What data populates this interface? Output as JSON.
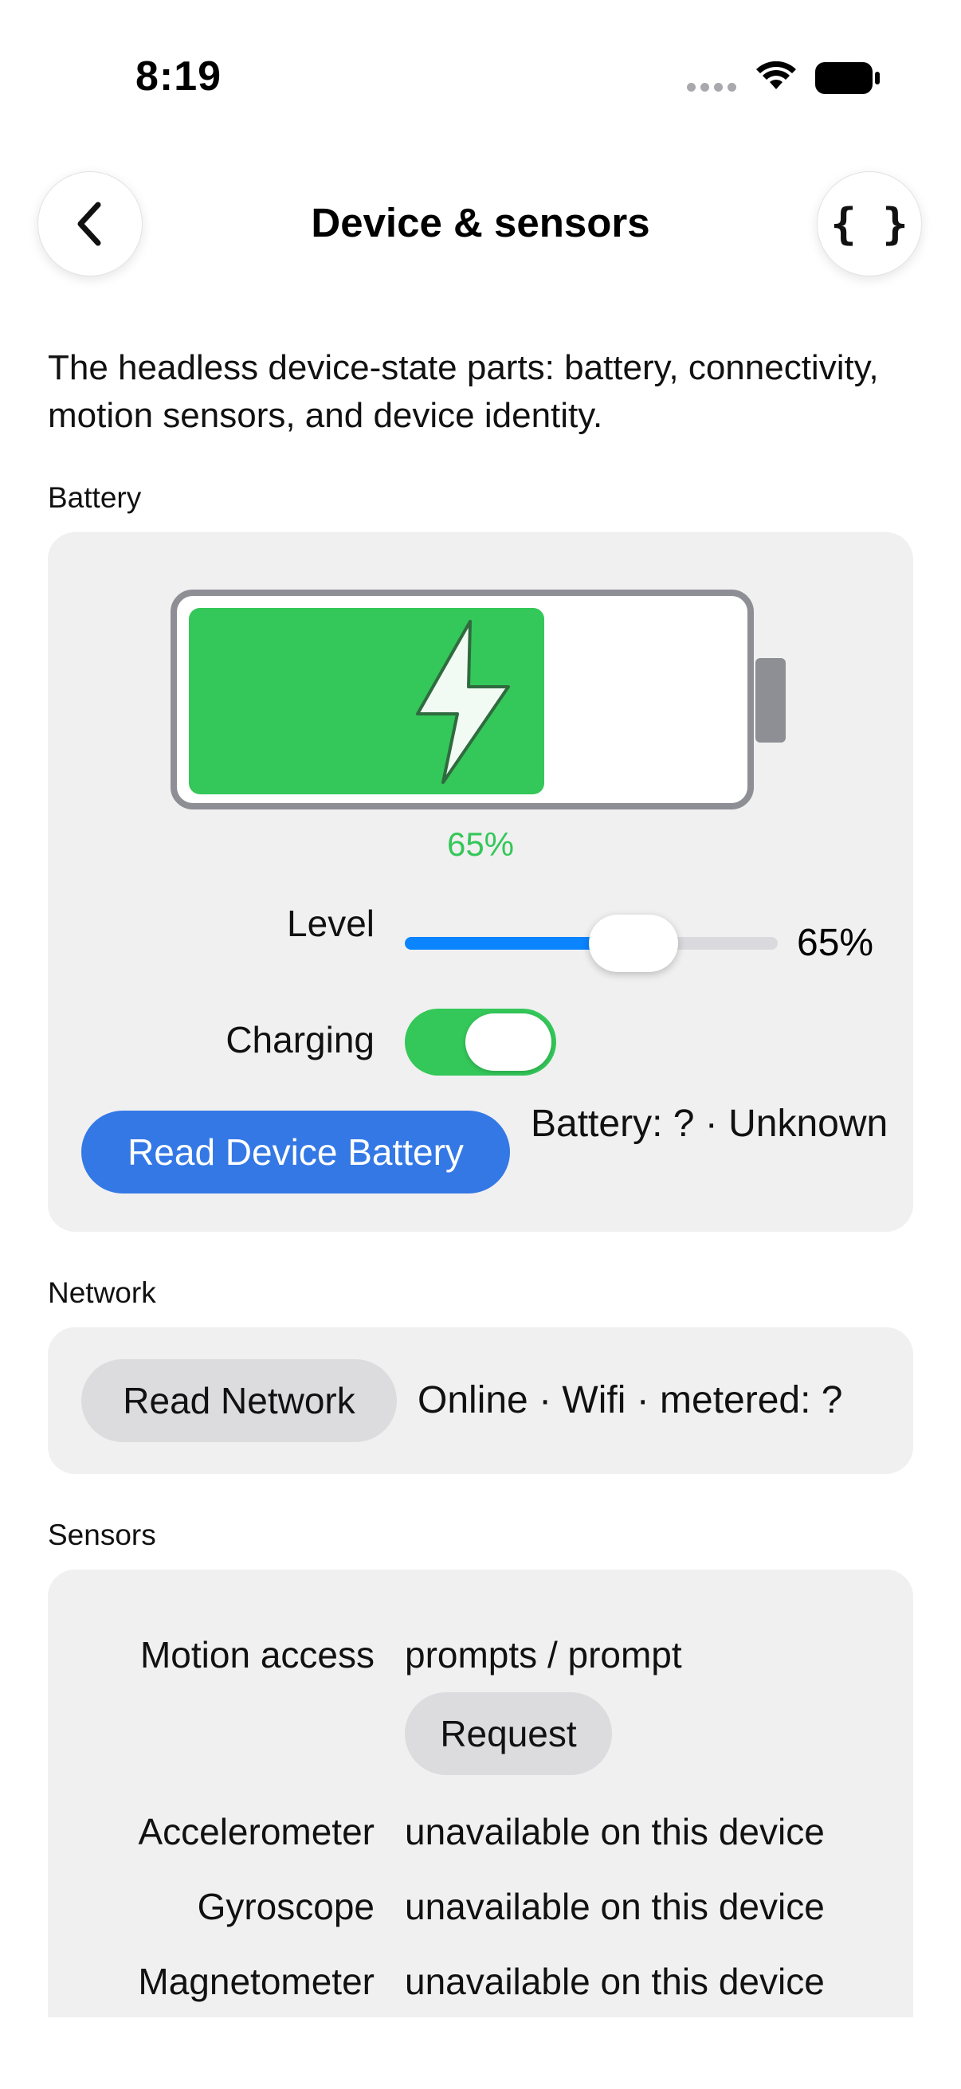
{
  "status_bar": {
    "time": "8:19"
  },
  "nav": {
    "title": "Device & sensors",
    "json_glyph": "{ }"
  },
  "description": "The headless device-state parts: battery, connectivity, motion sensors, and device identity.",
  "battery": {
    "section_label": "Battery",
    "level_percent": 65,
    "level_text": "65%",
    "level_label": "Level",
    "slider_value_text": "65%",
    "charging_label": "Charging",
    "charging": true,
    "read_button": "Read Device Battery",
    "status_text": "Battery: ? · Unknown"
  },
  "network": {
    "section_label": "Network",
    "read_button": "Read Network",
    "status_text": "Online · Wifi · metered: ?"
  },
  "sensors": {
    "section_label": "Sensors",
    "motion_access_label": "Motion access",
    "motion_access_value": "prompts / prompt",
    "request_button": "Request",
    "rows": [
      {
        "label": "Accelerometer",
        "value": "unavailable on this device"
      },
      {
        "label": "Gyroscope",
        "value": "unavailable on this device"
      },
      {
        "label": "Magnetometer",
        "value": "unavailable on this device"
      }
    ]
  },
  "colors": {
    "accent": "#3478e6",
    "green": "#34c759",
    "slider_blue": "#0a84ff",
    "card": "#f0f0f0"
  }
}
